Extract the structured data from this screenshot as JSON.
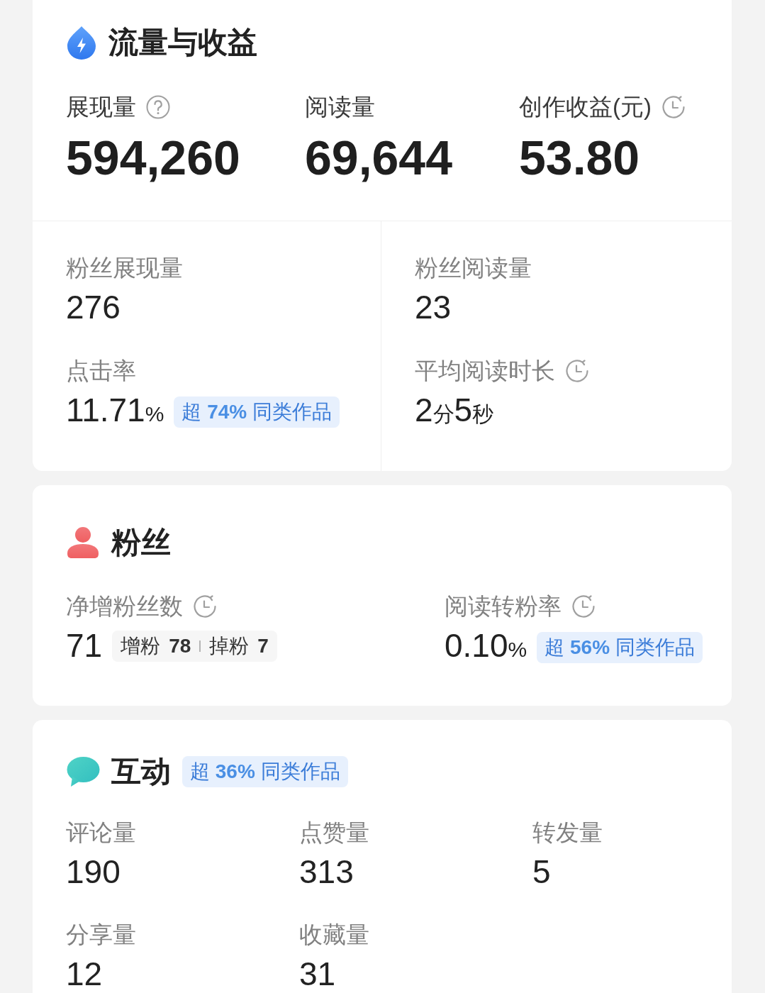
{
  "traffic": {
    "title": "流量与收益",
    "headline": [
      {
        "label": "展现量",
        "value": "594,260",
        "help": true,
        "delayed": false
      },
      {
        "label": "阅读量",
        "value": "69,644",
        "help": false,
        "delayed": false
      },
      {
        "label": "创作收益(元)",
        "value": "53.80",
        "help": false,
        "delayed": true
      }
    ],
    "columns": [
      [
        {
          "label": "粉丝展现量",
          "value": "276",
          "delayed": false
        },
        {
          "label": "点击率",
          "value": "11.71",
          "unit": "%",
          "delayed": false,
          "badge": "超 **74%** 同类作品"
        }
      ],
      [
        {
          "label": "粉丝阅读量",
          "value": "23",
          "delayed": false
        },
        {
          "label": "平均阅读时长",
          "value_parts": [
            {
              "kind": "number",
              "text": "2"
            },
            {
              "kind": "unit",
              "text": "分"
            },
            {
              "kind": "number",
              "text": "5"
            },
            {
              "kind": "unit",
              "text": "秒"
            }
          ],
          "delayed": true
        }
      ]
    ]
  },
  "fans": {
    "title": "粉丝",
    "metrics": [
      {
        "label": "净增粉丝数",
        "value": "71",
        "delayed": true,
        "changes": [
          {
            "label": "增粉",
            "value": "78"
          },
          {
            "label": "掉粉",
            "value": "7"
          }
        ]
      },
      {
        "label": "阅读转粉率",
        "value": "0.10",
        "unit": "%",
        "delayed": true,
        "badge": "超 **56%** 同类作品"
      }
    ]
  },
  "interaction": {
    "title": "互动",
    "badge": "超 **36%** 同类作品",
    "metrics": [
      {
        "label": "评论量",
        "value": "190",
        "delayed": false
      },
      {
        "label": "点赞量",
        "value": "313",
        "delayed": false
      },
      {
        "label": "转发量",
        "value": "5",
        "delayed": false
      },
      {
        "label": "分享量",
        "value": "12",
        "delayed": false
      },
      {
        "label": "收藏量",
        "value": "31",
        "delayed": false
      }
    ]
  }
}
